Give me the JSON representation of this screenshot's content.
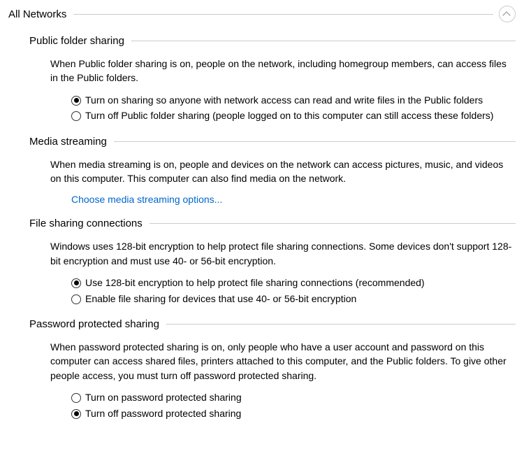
{
  "mainHeader": "All Networks",
  "sections": {
    "publicFolder": {
      "title": "Public folder sharing",
      "desc": "When Public folder sharing is on, people on the network, including homegroup members, can access files in the Public folders.",
      "opt1": "Turn on sharing so anyone with network access can read and write files in the Public folders",
      "opt2": "Turn off Public folder sharing (people logged on to this computer can still access these folders)"
    },
    "mediaStreaming": {
      "title": "Media streaming",
      "desc": "When media streaming is on, people and devices on the network can access pictures, music, and videos on this computer. This computer can also find media on the network.",
      "link": "Choose media streaming options..."
    },
    "fileSharing": {
      "title": "File sharing connections",
      "desc": "Windows uses 128-bit encryption to help protect file sharing connections. Some devices don't support 128-bit encryption and must use 40- or 56-bit encryption.",
      "opt1": "Use 128-bit encryption to help protect file sharing connections (recommended)",
      "opt2": "Enable file sharing for devices that use 40- or 56-bit encryption"
    },
    "passwordProtected": {
      "title": "Password protected sharing",
      "desc": "When password protected sharing is on, only people who have a user account and password on this computer can access shared files, printers attached to this computer, and the Public folders. To give other people access, you must turn off password protected sharing.",
      "opt1": "Turn on password protected sharing",
      "opt2": "Turn off password protected sharing"
    }
  }
}
